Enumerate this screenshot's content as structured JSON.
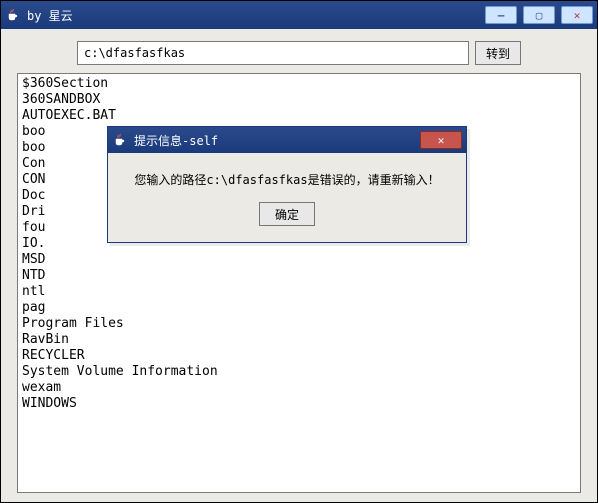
{
  "window": {
    "title": "by 星云"
  },
  "toolbar": {
    "path_value": "c:\\dfasfasfkas",
    "go_label": "转到"
  },
  "listing": {
    "items": [
      "$360Section",
      "360SANDBOX",
      "AUTOEXEC.BAT",
      "boo",
      "boo",
      "Con",
      "CON",
      "Doc",
      "Dri",
      "fou",
      "IO.",
      "MSD",
      "NTD",
      "ntl",
      "pag",
      "Program Files",
      "RavBin",
      "RECYCLER",
      "System Volume Information",
      "wexam",
      "WINDOWS"
    ]
  },
  "dialog": {
    "title": "提示信息-self",
    "message": "您输入的路径c:\\dfasfasfkas是错误的，请重新输入！",
    "ok_label": "确定"
  }
}
